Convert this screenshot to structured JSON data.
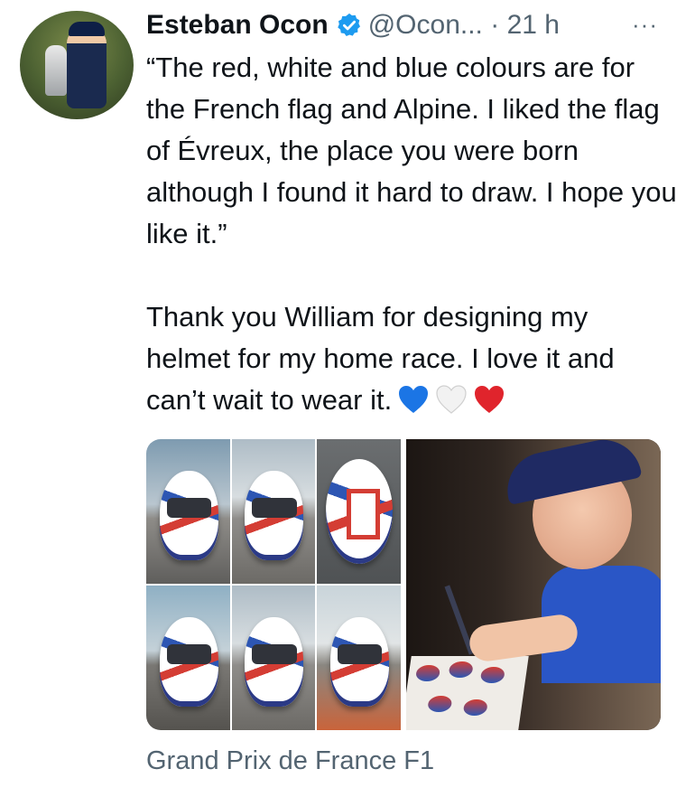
{
  "tweet": {
    "author_name": "Esteban Ocon",
    "handle": "@Ocon...",
    "separator": "·",
    "time": "21 h",
    "more_label": "···",
    "text_paragraphs": [
      "“The red, white and blue colours are for the French flag and Alpine. I liked the flag of Évreux, the place you were born although I found it hard to draw. I hope you like it.”",
      "Thank you William for designing my helmet for my home race. I love it and can’t wait to wear it."
    ],
    "emojis": [
      "blue-heart-icon",
      "white-heart-icon",
      "red-heart-icon"
    ],
    "place": "Grand Prix de France F1"
  },
  "colors": {
    "text": "#0f1419",
    "secondary": "#536471",
    "verified": "#1d9bf0",
    "blue_heart": "#1b75e5",
    "red_heart": "#e0242c"
  }
}
